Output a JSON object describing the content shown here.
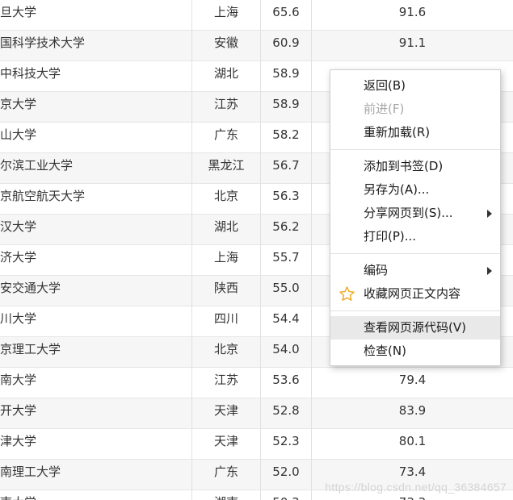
{
  "rows": [
    {
      "name": "复旦大学",
      "province": "上海",
      "score": "65.6",
      "score2": "91.6"
    },
    {
      "name": "中国科学技术大学",
      "province": "安徽",
      "score": "60.9",
      "score2": "91.1"
    },
    {
      "name": "华中科技大学",
      "province": "湖北",
      "score": "58.9",
      "score2": ""
    },
    {
      "name": "南京大学",
      "province": "江苏",
      "score": "58.9",
      "score2": ""
    },
    {
      "name": "中山大学",
      "province": "广东",
      "score": "58.2",
      "score2": ""
    },
    {
      "name": "哈尔滨工业大学",
      "province": "黑龙江",
      "score": "56.7",
      "score2": ""
    },
    {
      "name": "北京航空航天大学",
      "province": "北京",
      "score": "56.3",
      "score2": ""
    },
    {
      "name": "武汉大学",
      "province": "湖北",
      "score": "56.2",
      "score2": ""
    },
    {
      "name": "同济大学",
      "province": "上海",
      "score": "55.7",
      "score2": ""
    },
    {
      "name": "西安交通大学",
      "province": "陕西",
      "score": "55.0",
      "score2": ""
    },
    {
      "name": "四川大学",
      "province": "四川",
      "score": "54.4",
      "score2": ""
    },
    {
      "name": "北京理工大学",
      "province": "北京",
      "score": "54.0",
      "score2": ""
    },
    {
      "name": "东南大学",
      "province": "江苏",
      "score": "53.6",
      "score2": "79.4"
    },
    {
      "name": "南开大学",
      "province": "天津",
      "score": "52.8",
      "score2": "83.9"
    },
    {
      "name": "天津大学",
      "province": "天津",
      "score": "52.3",
      "score2": "80.1"
    },
    {
      "name": "华南理工大学",
      "province": "广东",
      "score": "52.0",
      "score2": "73.4"
    },
    {
      "name": "中南大学",
      "province": "湖南",
      "score": "50.3",
      "score2": "73.3"
    }
  ],
  "context_menu": {
    "back": "返回(B)",
    "forward": "前进(F)",
    "reload": "重新加载(R)",
    "bookmark": "添加到书签(D)",
    "save_as": "另存为(A)...",
    "share": "分享网页到(S)...",
    "print": "打印(P)...",
    "encoding": "编码",
    "collect": "收藏网页正文内容",
    "view_source": "查看网页源代码(V)",
    "inspect": "检查(N)"
  },
  "watermark": "https://blog.csdn.net/qq_36384657",
  "colors": {
    "star": "#f0a81c",
    "row_alt": "#f6f6f6",
    "menu_hover": "#e9e9e9"
  }
}
